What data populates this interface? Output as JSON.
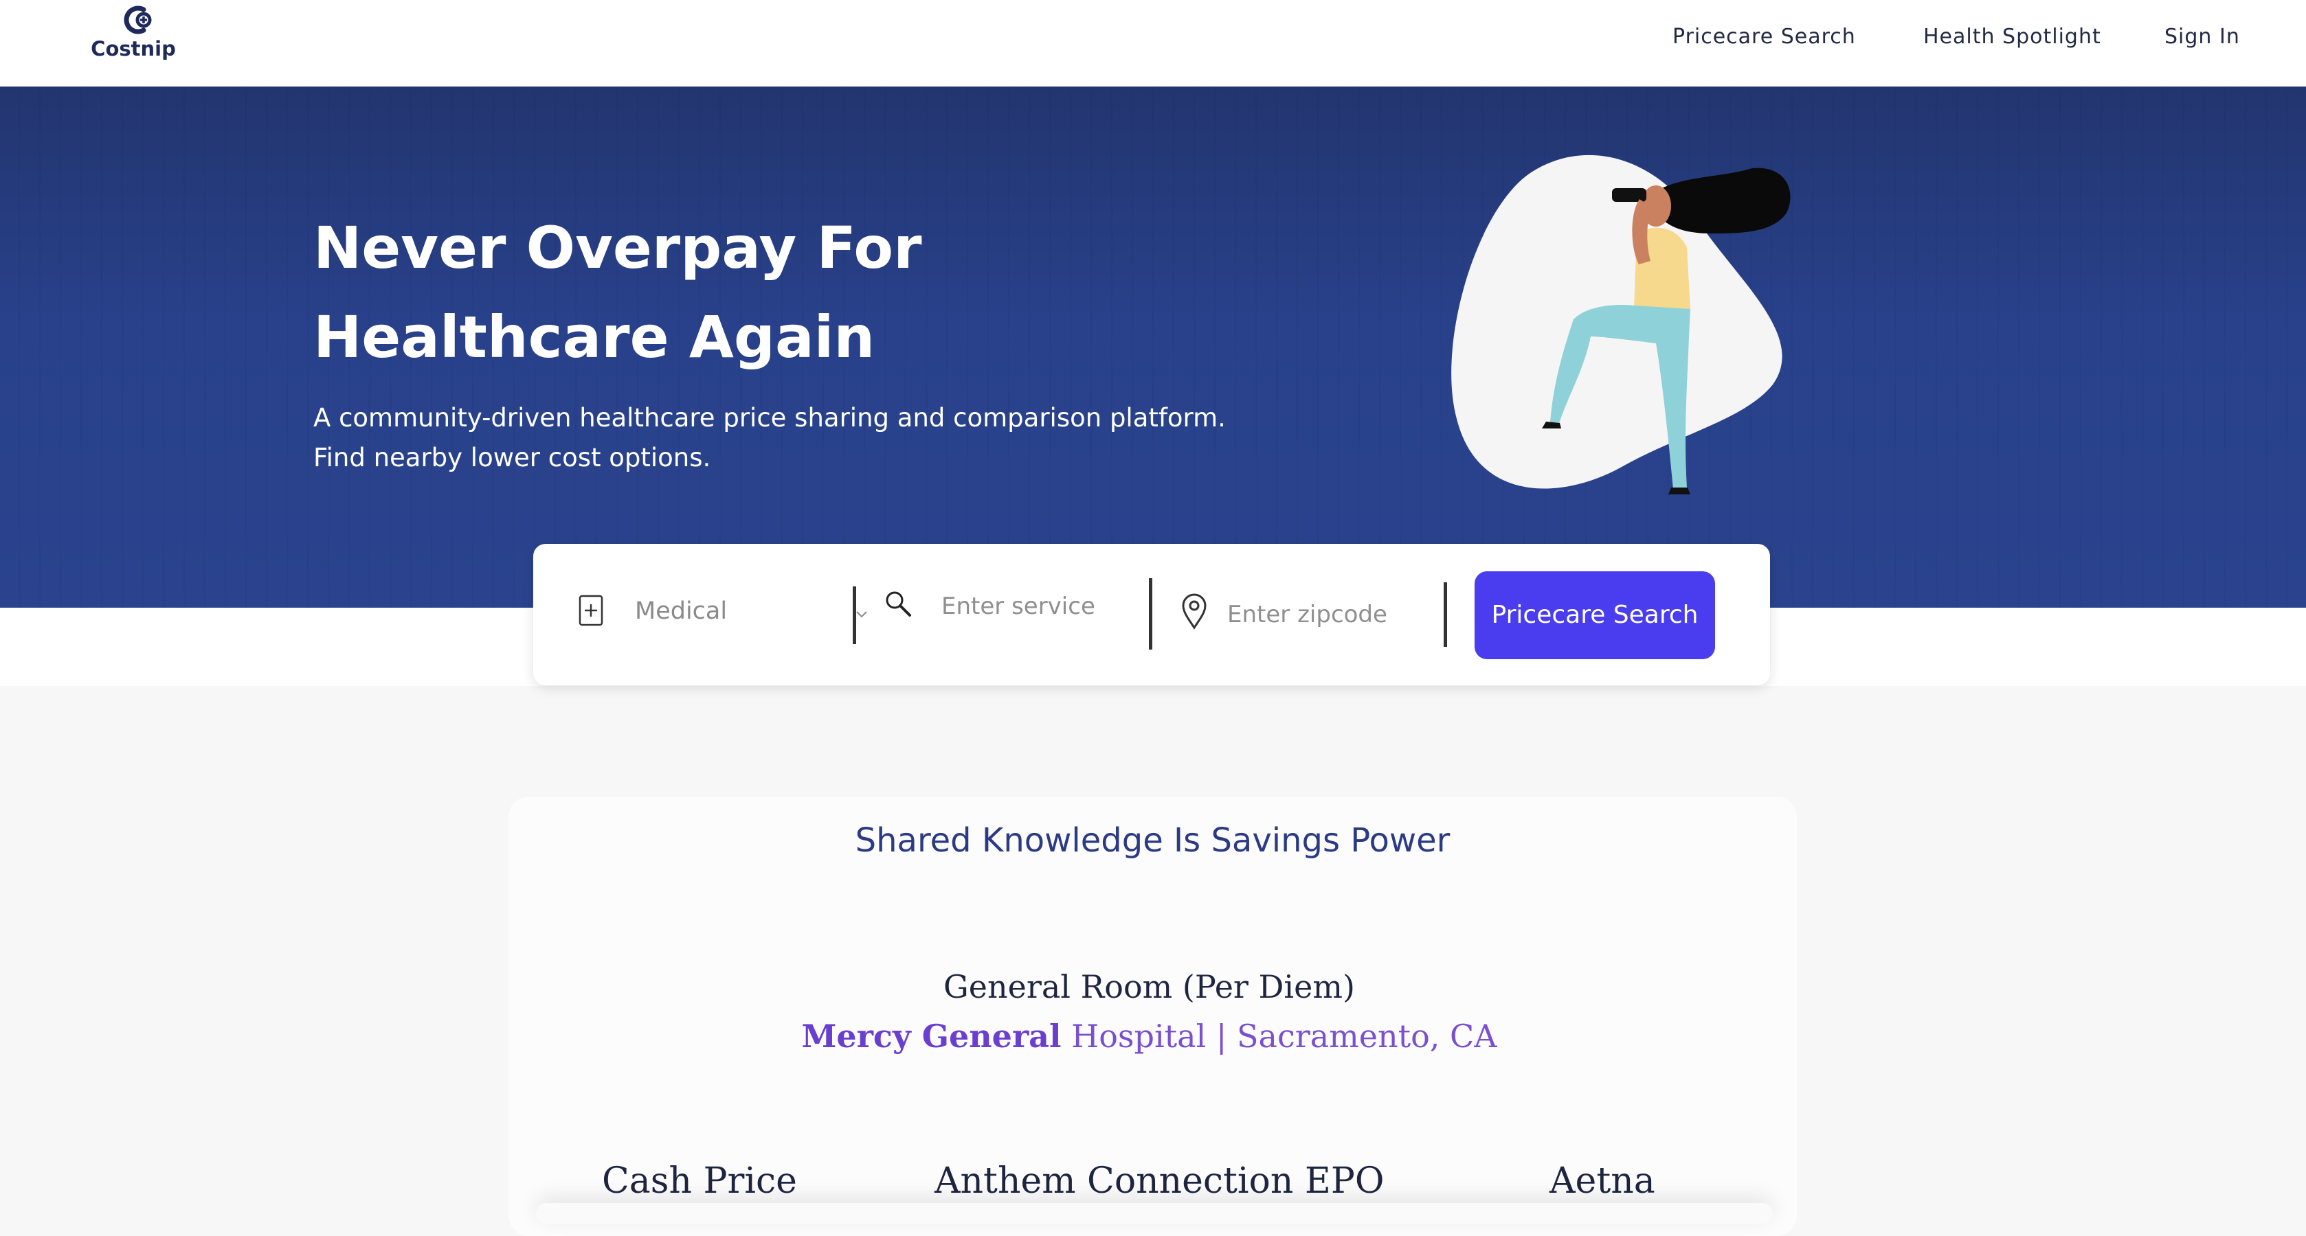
{
  "brand": {
    "name": "Costnip"
  },
  "nav": {
    "items": [
      "Pricecare Search",
      "Health Spotlight",
      "Sign In"
    ]
  },
  "hero": {
    "title": "Never Overpay For Healthcare Again",
    "subtitle_line1": "A community-driven healthcare price sharing and comparison platform.",
    "subtitle_line2": "Find nearby lower cost options."
  },
  "search": {
    "category_selected": "Medical",
    "service_placeholder": "Enter service",
    "zip_placeholder": "Enter zipcode",
    "button_label": "Pricecare Search"
  },
  "spotlight": {
    "title": "Shared Knowledge Is Savings Power",
    "service": "General Room (Per Diem)",
    "facility_bold": "Mercy General",
    "facility_rest": "Hospital | Sacramento, CA",
    "columns": [
      "Cash Price",
      "Anthem Connection EPO",
      "Aetna"
    ]
  },
  "colors": {
    "hero_bg": "#28418a",
    "button": "#4a3df0",
    "title": "#2b3a85",
    "facility": "#7a4fd1"
  },
  "icons": [
    "logo-icon",
    "medical-bag-icon",
    "chevron-down-icon",
    "search-icon",
    "location-pin-icon"
  ]
}
